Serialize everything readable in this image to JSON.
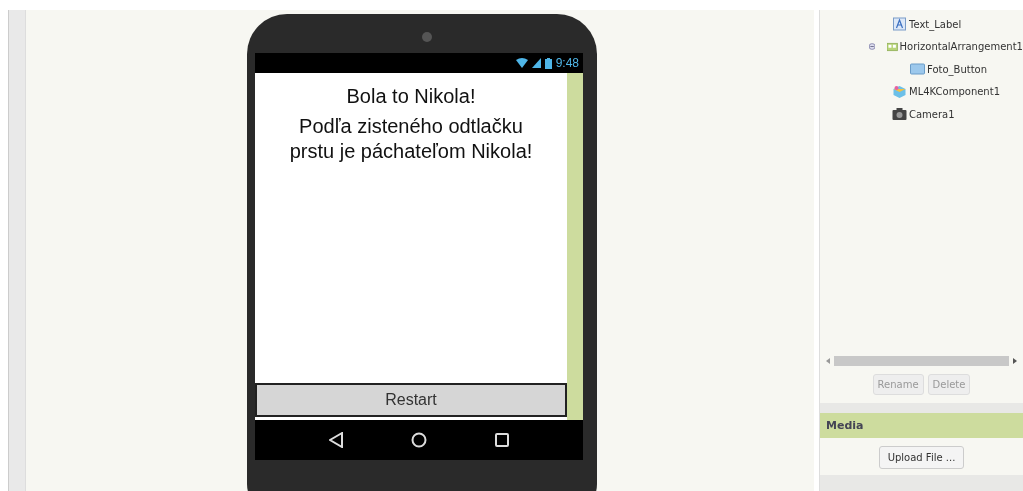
{
  "phone": {
    "status_time": "9:48",
    "labels": [
      "Bola to Nikola!",
      "Podľa zisteného odtlačku prstu je páchateľom Nikola!"
    ],
    "button": "Restart"
  },
  "components": {
    "items": [
      {
        "label": "Text_Label",
        "kind": "label"
      },
      {
        "label": "HorizontalArrangement1",
        "kind": "arrangement",
        "expanded": true,
        "children": [
          {
            "label": "Foto_Button",
            "kind": "button"
          }
        ]
      },
      {
        "label": "ML4KComponent1",
        "kind": "ml"
      },
      {
        "label": "Camera1",
        "kind": "camera"
      }
    ],
    "buttons": [
      "Rename",
      "Delete"
    ]
  },
  "media": {
    "title": "Media",
    "button": "Upload File ..."
  }
}
